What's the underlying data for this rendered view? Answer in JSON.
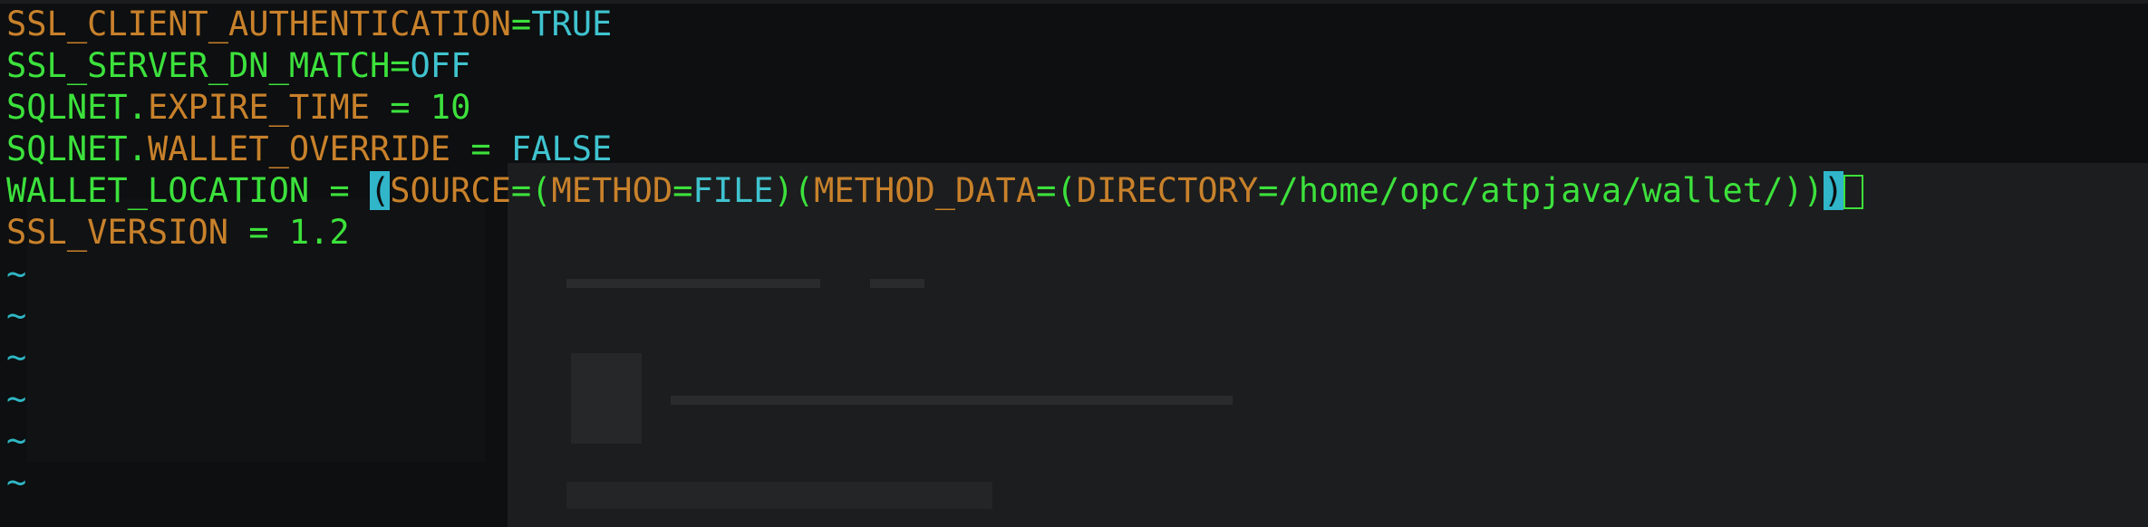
{
  "editor": {
    "lines": [
      [
        {
          "text": "SSL_CLIENT_AUTHENTICATION",
          "color": "orange"
        },
        {
          "text": "=",
          "color": "green"
        },
        {
          "text": "TRUE",
          "color": "cyan"
        }
      ],
      [
        {
          "text": "SSL_SERVER_DN_MATCH",
          "color": "green"
        },
        {
          "text": "=",
          "color": "green"
        },
        {
          "text": "OFF",
          "color": "cyan"
        }
      ],
      [
        {
          "text": "SQLNET.",
          "color": "green"
        },
        {
          "text": "EXPIRE_TIME",
          "color": "orange"
        },
        {
          "text": " = 10",
          "color": "green"
        }
      ],
      [
        {
          "text": "SQLNET.",
          "color": "green"
        },
        {
          "text": "WALLET_OVERRIDE",
          "color": "orange"
        },
        {
          "text": " = ",
          "color": "green"
        },
        {
          "text": "FALSE",
          "color": "cyan"
        }
      ],
      [
        {
          "text": "WALLET_LOCATION = ",
          "color": "green"
        },
        {
          "text": "(",
          "color": "orange",
          "highlight": true
        },
        {
          "text": "SOURCE",
          "color": "orange"
        },
        {
          "text": "=(",
          "color": "green"
        },
        {
          "text": "METHOD",
          "color": "orange"
        },
        {
          "text": "=",
          "color": "green"
        },
        {
          "text": "FILE",
          "color": "cyan"
        },
        {
          "text": ")(",
          "color": "green"
        },
        {
          "text": "METHOD_DATA",
          "color": "orange"
        },
        {
          "text": "=(",
          "color": "green"
        },
        {
          "text": "DIRECTORY",
          "color": "orange"
        },
        {
          "text": "=/home/opc/atpjava/wallet/))",
          "color": "green"
        },
        {
          "text": ")",
          "color": "green",
          "highlight": true
        }
      ],
      [
        {
          "text": "SSL_VERSION",
          "color": "orange"
        },
        {
          "text": " = 1.2",
          "color": "green"
        }
      ]
    ],
    "empty_line_markers": [
      "~",
      "~",
      "~",
      "~",
      "~",
      "~"
    ],
    "colors": {
      "orange": "#c8812b",
      "green": "#3ce13c",
      "cyan": "#3fc3cf",
      "tilde": "#2fb6c4",
      "cursor": "#30b5c9",
      "background": "#0d0f10"
    }
  }
}
